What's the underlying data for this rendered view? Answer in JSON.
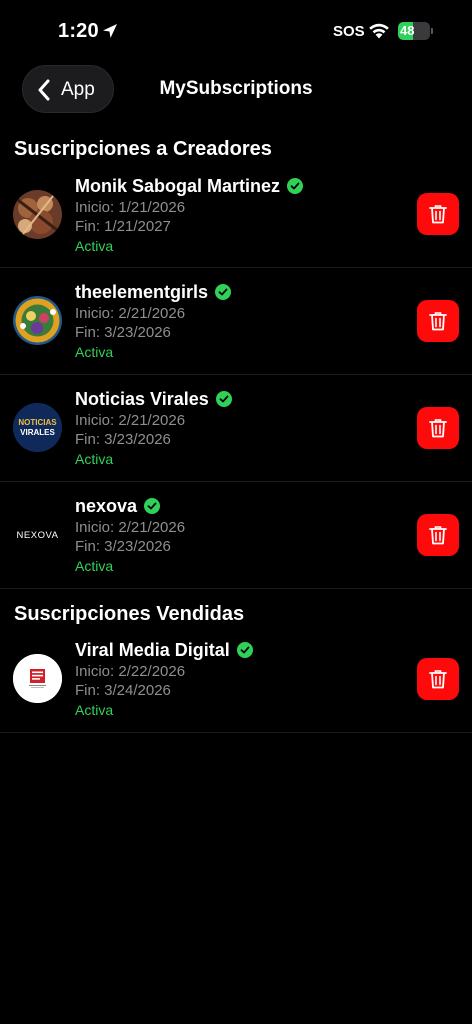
{
  "status_bar": {
    "time": "1:20",
    "carrier": "SOS",
    "battery_level": "48",
    "battery_fraction": 0.48
  },
  "nav": {
    "back_label": "App",
    "title": "MySubscriptions"
  },
  "colors": {
    "background": "#000000",
    "active_green": "#30d158",
    "delete_red": "#ff0a0a",
    "meta_gray": "#8e8e93",
    "verified_green": "#30d158"
  },
  "sections": [
    {
      "title": "Suscripciones a Creadores",
      "items": [
        {
          "name": "Monik Sabogal Martinez",
          "start": "Inicio: 1/21/2026",
          "end": "Fin: 1/21/2027",
          "status": "Activa",
          "avatar_icon": "photo-avatar-icon"
        },
        {
          "name": "theelementgirls",
          "start": "Inicio: 2/21/2026",
          "end": "Fin: 3/23/2026",
          "status": "Activa",
          "avatar_icon": "illustration-avatar-icon"
        },
        {
          "name": "Noticias Virales",
          "start": "Inicio: 2/21/2026",
          "end": "Fin: 3/23/2026",
          "status": "Activa",
          "avatar_icon": "noticias-virales-logo",
          "avatar_text_1": "NOTICIAS",
          "avatar_text_2": "VIRALES"
        },
        {
          "name": "nexova",
          "start": "Inicio: 2/21/2026",
          "end": "Fin: 3/23/2026",
          "status": "Activa",
          "avatar_icon": "nexova-logo",
          "avatar_text": "NEXOVA"
        }
      ]
    },
    {
      "title": "Suscripciones Vendidas",
      "items": [
        {
          "name": "Viral Media Digital",
          "start": "Inicio: 2/22/2026",
          "end": "Fin: 3/24/2026",
          "status": "Activa",
          "avatar_icon": "viral-media-digital-logo"
        }
      ]
    }
  ]
}
